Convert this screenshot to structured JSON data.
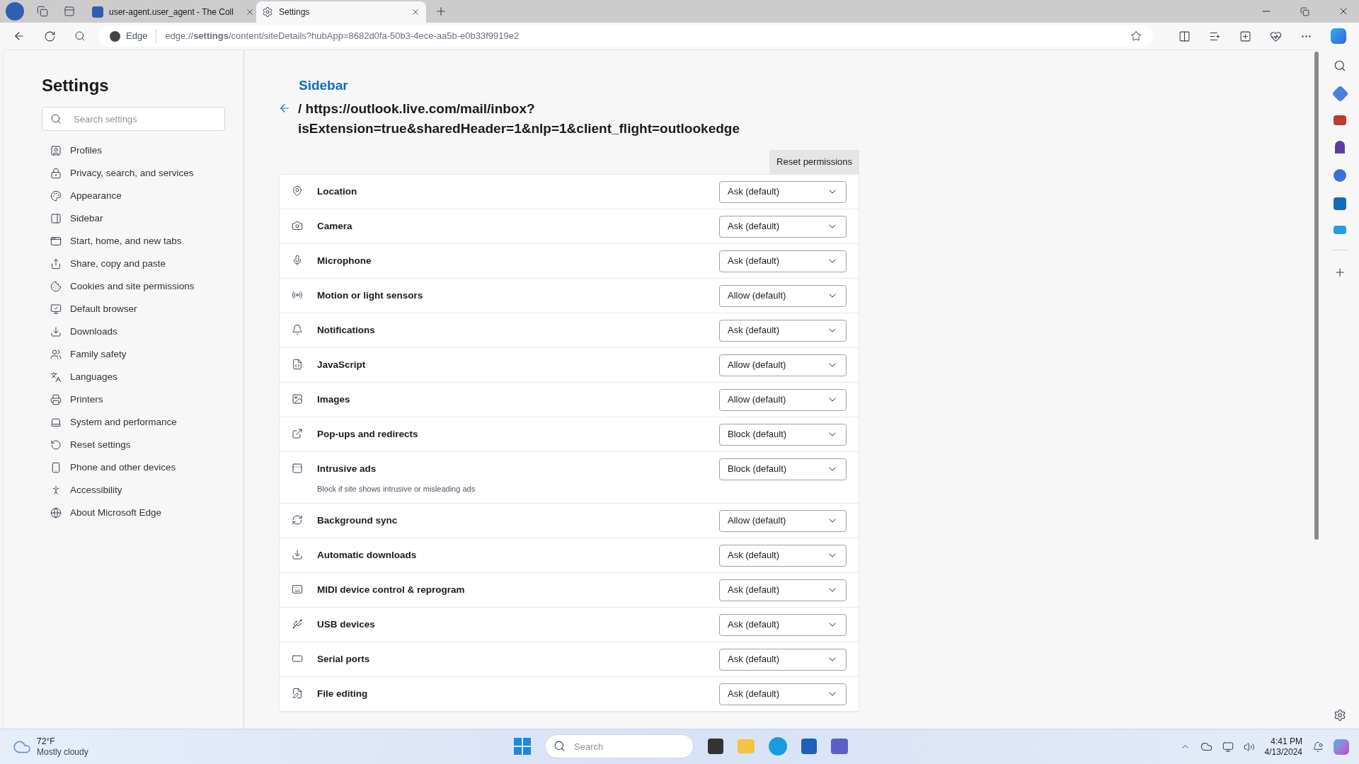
{
  "browser": {
    "tabs": [
      {
        "title": "user-agent.user_agent - The Coll",
        "selected": false
      },
      {
        "title": "Settings",
        "selected": true
      }
    ],
    "address": {
      "site": "Edge",
      "url": "edge://**settings**/content/siteDetails?hubApp=8682d0fa-50b3-4ece-aa5b-e0b33f9919e2"
    }
  },
  "settings_nav": {
    "title": "Settings",
    "search": {
      "placeholder": "Search settings"
    },
    "items": [
      {
        "label": "Profiles"
      },
      {
        "label": "Privacy, search, and services"
      },
      {
        "label": "Appearance"
      },
      {
        "label": "Sidebar"
      },
      {
        "label": "Start, home, and new tabs"
      },
      {
        "label": "Share, copy and paste"
      },
      {
        "label": "Cookies and site permissions"
      },
      {
        "label": "Default browser"
      },
      {
        "label": "Downloads"
      },
      {
        "label": "Family safety"
      },
      {
        "label": "Languages"
      },
      {
        "label": "Printers"
      },
      {
        "label": "System and performance"
      },
      {
        "label": "Reset settings"
      },
      {
        "label": "Phone and other devices"
      },
      {
        "label": "Accessibility"
      },
      {
        "label": "About Microsoft Edge"
      }
    ]
  },
  "page": {
    "breadcrumb": "Sidebar",
    "heading_lines": [
      "/ https://outlook.live.com/mail/inbox?",
      "isExtension=true&sharedHeader=1&nlp=1&client_flight=outlookedge"
    ],
    "reset_button": "Reset permissions",
    "permissions": [
      {
        "label": "Location",
        "value": "Ask (default)"
      },
      {
        "label": "Camera",
        "value": "Ask (default)"
      },
      {
        "label": "Microphone",
        "value": "Ask (default)"
      },
      {
        "label": "Motion or light sensors",
        "value": "Allow (default)"
      },
      {
        "label": "Notifications",
        "value": "Ask (default)"
      },
      {
        "label": "JavaScript",
        "value": "Allow (default)"
      },
      {
        "label": "Images",
        "value": "Allow (default)"
      },
      {
        "label": "Pop-ups and redirects",
        "value": "Block (default)"
      },
      {
        "label": "Intrusive ads",
        "value": "Block (default)",
        "description": "Block if site shows intrusive or misleading ads"
      },
      {
        "label": "Background sync",
        "value": "Allow (default)"
      },
      {
        "label": "Automatic downloads",
        "value": "Ask (default)"
      },
      {
        "label": "MIDI device control & reprogram",
        "value": "Ask (default)"
      },
      {
        "label": "USB devices",
        "value": "Ask (default)"
      },
      {
        "label": "Serial ports",
        "value": "Ask (default)"
      },
      {
        "label": "File editing",
        "value": "Ask (default)"
      }
    ]
  },
  "taskbar": {
    "weather": {
      "temp": "72°F",
      "condition": "Mostly cloudy"
    },
    "search": {
      "placeholder": "Search"
    },
    "clock": {
      "time": "4:41 PM",
      "date": "4/13/2024"
    }
  }
}
